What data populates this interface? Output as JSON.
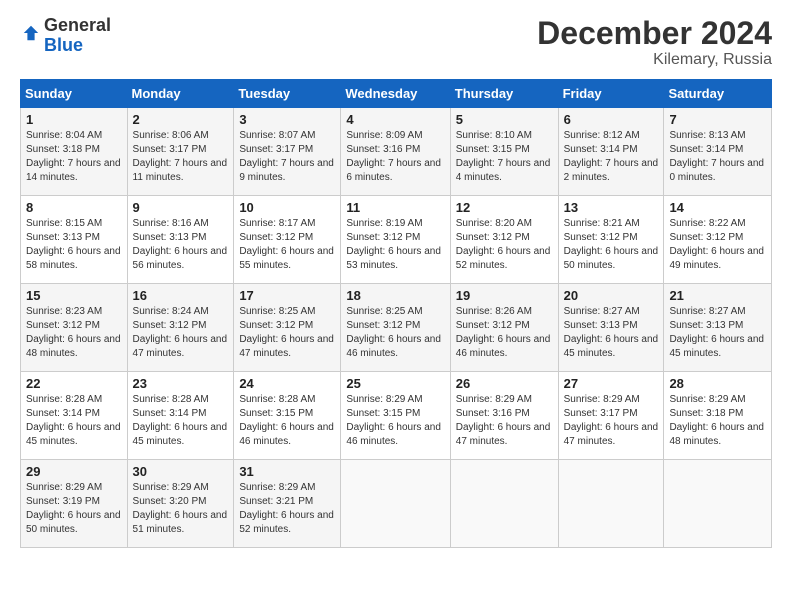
{
  "header": {
    "logo_general": "General",
    "logo_blue": "Blue",
    "month_title": "December 2024",
    "location": "Kilemary, Russia"
  },
  "days_of_week": [
    "Sunday",
    "Monday",
    "Tuesday",
    "Wednesday",
    "Thursday",
    "Friday",
    "Saturday"
  ],
  "weeks": [
    [
      {
        "day": "1",
        "sunrise": "Sunrise: 8:04 AM",
        "sunset": "Sunset: 3:18 PM",
        "daylight": "Daylight: 7 hours and 14 minutes."
      },
      {
        "day": "2",
        "sunrise": "Sunrise: 8:06 AM",
        "sunset": "Sunset: 3:17 PM",
        "daylight": "Daylight: 7 hours and 11 minutes."
      },
      {
        "day": "3",
        "sunrise": "Sunrise: 8:07 AM",
        "sunset": "Sunset: 3:17 PM",
        "daylight": "Daylight: 7 hours and 9 minutes."
      },
      {
        "day": "4",
        "sunrise": "Sunrise: 8:09 AM",
        "sunset": "Sunset: 3:16 PM",
        "daylight": "Daylight: 7 hours and 6 minutes."
      },
      {
        "day": "5",
        "sunrise": "Sunrise: 8:10 AM",
        "sunset": "Sunset: 3:15 PM",
        "daylight": "Daylight: 7 hours and 4 minutes."
      },
      {
        "day": "6",
        "sunrise": "Sunrise: 8:12 AM",
        "sunset": "Sunset: 3:14 PM",
        "daylight": "Daylight: 7 hours and 2 minutes."
      },
      {
        "day": "7",
        "sunrise": "Sunrise: 8:13 AM",
        "sunset": "Sunset: 3:14 PM",
        "daylight": "Daylight: 7 hours and 0 minutes."
      }
    ],
    [
      {
        "day": "8",
        "sunrise": "Sunrise: 8:15 AM",
        "sunset": "Sunset: 3:13 PM",
        "daylight": "Daylight: 6 hours and 58 minutes."
      },
      {
        "day": "9",
        "sunrise": "Sunrise: 8:16 AM",
        "sunset": "Sunset: 3:13 PM",
        "daylight": "Daylight: 6 hours and 56 minutes."
      },
      {
        "day": "10",
        "sunrise": "Sunrise: 8:17 AM",
        "sunset": "Sunset: 3:12 PM",
        "daylight": "Daylight: 6 hours and 55 minutes."
      },
      {
        "day": "11",
        "sunrise": "Sunrise: 8:19 AM",
        "sunset": "Sunset: 3:12 PM",
        "daylight": "Daylight: 6 hours and 53 minutes."
      },
      {
        "day": "12",
        "sunrise": "Sunrise: 8:20 AM",
        "sunset": "Sunset: 3:12 PM",
        "daylight": "Daylight: 6 hours and 52 minutes."
      },
      {
        "day": "13",
        "sunrise": "Sunrise: 8:21 AM",
        "sunset": "Sunset: 3:12 PM",
        "daylight": "Daylight: 6 hours and 50 minutes."
      },
      {
        "day": "14",
        "sunrise": "Sunrise: 8:22 AM",
        "sunset": "Sunset: 3:12 PM",
        "daylight": "Daylight: 6 hours and 49 minutes."
      }
    ],
    [
      {
        "day": "15",
        "sunrise": "Sunrise: 8:23 AM",
        "sunset": "Sunset: 3:12 PM",
        "daylight": "Daylight: 6 hours and 48 minutes."
      },
      {
        "day": "16",
        "sunrise": "Sunrise: 8:24 AM",
        "sunset": "Sunset: 3:12 PM",
        "daylight": "Daylight: 6 hours and 47 minutes."
      },
      {
        "day": "17",
        "sunrise": "Sunrise: 8:25 AM",
        "sunset": "Sunset: 3:12 PM",
        "daylight": "Daylight: 6 hours and 47 minutes."
      },
      {
        "day": "18",
        "sunrise": "Sunrise: 8:25 AM",
        "sunset": "Sunset: 3:12 PM",
        "daylight": "Daylight: 6 hours and 46 minutes."
      },
      {
        "day": "19",
        "sunrise": "Sunrise: 8:26 AM",
        "sunset": "Sunset: 3:12 PM",
        "daylight": "Daylight: 6 hours and 46 minutes."
      },
      {
        "day": "20",
        "sunrise": "Sunrise: 8:27 AM",
        "sunset": "Sunset: 3:13 PM",
        "daylight": "Daylight: 6 hours and 45 minutes."
      },
      {
        "day": "21",
        "sunrise": "Sunrise: 8:27 AM",
        "sunset": "Sunset: 3:13 PM",
        "daylight": "Daylight: 6 hours and 45 minutes."
      }
    ],
    [
      {
        "day": "22",
        "sunrise": "Sunrise: 8:28 AM",
        "sunset": "Sunset: 3:14 PM",
        "daylight": "Daylight: 6 hours and 45 minutes."
      },
      {
        "day": "23",
        "sunrise": "Sunrise: 8:28 AM",
        "sunset": "Sunset: 3:14 PM",
        "daylight": "Daylight: 6 hours and 45 minutes."
      },
      {
        "day": "24",
        "sunrise": "Sunrise: 8:28 AM",
        "sunset": "Sunset: 3:15 PM",
        "daylight": "Daylight: 6 hours and 46 minutes."
      },
      {
        "day": "25",
        "sunrise": "Sunrise: 8:29 AM",
        "sunset": "Sunset: 3:15 PM",
        "daylight": "Daylight: 6 hours and 46 minutes."
      },
      {
        "day": "26",
        "sunrise": "Sunrise: 8:29 AM",
        "sunset": "Sunset: 3:16 PM",
        "daylight": "Daylight: 6 hours and 47 minutes."
      },
      {
        "day": "27",
        "sunrise": "Sunrise: 8:29 AM",
        "sunset": "Sunset: 3:17 PM",
        "daylight": "Daylight: 6 hours and 47 minutes."
      },
      {
        "day": "28",
        "sunrise": "Sunrise: 8:29 AM",
        "sunset": "Sunset: 3:18 PM",
        "daylight": "Daylight: 6 hours and 48 minutes."
      }
    ],
    [
      {
        "day": "29",
        "sunrise": "Sunrise: 8:29 AM",
        "sunset": "Sunset: 3:19 PM",
        "daylight": "Daylight: 6 hours and 50 minutes."
      },
      {
        "day": "30",
        "sunrise": "Sunrise: 8:29 AM",
        "sunset": "Sunset: 3:20 PM",
        "daylight": "Daylight: 6 hours and 51 minutes."
      },
      {
        "day": "31",
        "sunrise": "Sunrise: 8:29 AM",
        "sunset": "Sunset: 3:21 PM",
        "daylight": "Daylight: 6 hours and 52 minutes."
      },
      null,
      null,
      null,
      null
    ]
  ]
}
